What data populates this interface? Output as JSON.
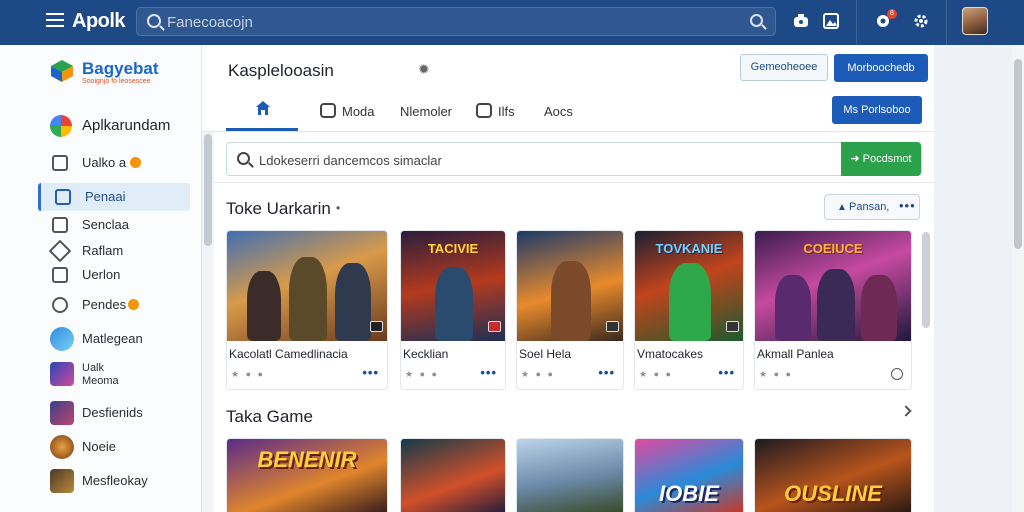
{
  "app": {
    "name": "Apolk",
    "search_placeholder": "Fanecoacojn"
  },
  "topbar": {
    "icons": [
      "controller-icon",
      "image-icon",
      "notification-icon",
      "gear-icon"
    ],
    "notification_count": "8"
  },
  "sidebar": {
    "brand_title": "Bagyebat",
    "brand_subtitle": "Sooignjo fo leosescee",
    "app_label": "Aplkarundam",
    "items": [
      {
        "label": "Ualko a",
        "badge": true,
        "active": false
      },
      {
        "label": "Penaai",
        "badge": false,
        "active": true
      },
      {
        "label": "Senclaa",
        "badge": false,
        "active": false
      },
      {
        "label": "Raflam",
        "badge": false,
        "active": false
      },
      {
        "label": "Uerlon",
        "badge": false,
        "active": false
      },
      {
        "label": "Pendes",
        "badge": true,
        "active": false
      }
    ],
    "games": [
      {
        "label": "Matlegean"
      },
      {
        "label": "Ualk\nMeoma"
      },
      {
        "label": "Desfienids"
      },
      {
        "label": "Noeie"
      },
      {
        "label": "Mesfleokay"
      }
    ]
  },
  "main": {
    "title": "Kasplelooasin",
    "btn_outline": "Gemeoheoee",
    "btn_primary": "Morboochedb",
    "btn_primary2": "Ms Porlsoboo",
    "tabs": [
      {
        "label": "Moda"
      },
      {
        "label": "Nlemoler"
      },
      {
        "label": "Ilfs"
      },
      {
        "label": "Aocs"
      }
    ],
    "search_placeholder": "Ldokeserri dancemcos simaclar",
    "search_button": "Pocdsmot",
    "section1": {
      "title": "Toke Uarkarin",
      "action_label": "Pansan,",
      "cards": [
        {
          "name": "Kacolatl Camedlinacia",
          "art_text": ""
        },
        {
          "name": "Kecklian",
          "art_text": "TACIVIE"
        },
        {
          "name": "Soel Hela",
          "art_text": ""
        },
        {
          "name": "Vmatocakes",
          "art_text": "TOVKANIE"
        },
        {
          "name": "Akmall Panlea",
          "art_text": "COEIUCE"
        }
      ]
    },
    "section2": {
      "title": "Taka Game",
      "cards": [
        {
          "art_text": "BENENIR"
        },
        {
          "art_text": ""
        },
        {
          "art_text": ""
        },
        {
          "art_text": "IOBIE"
        },
        {
          "art_text": "OUSLINE"
        }
      ]
    }
  },
  "colors": {
    "topbar": "#1d4a86",
    "primary": "#1c5bb8",
    "success": "#2aa14a",
    "badge_orange": "#f0950c"
  }
}
